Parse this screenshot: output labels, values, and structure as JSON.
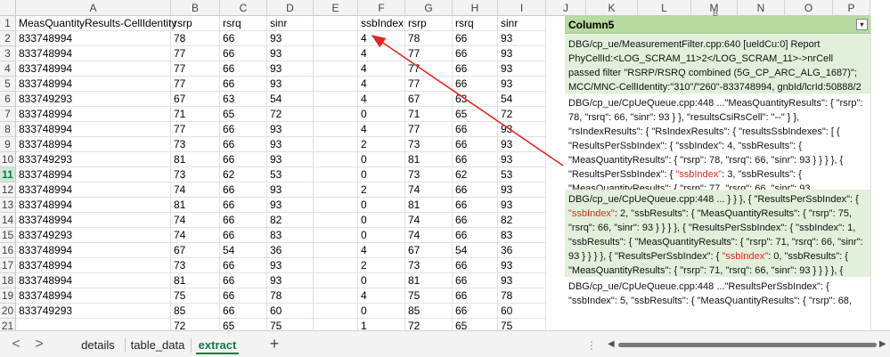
{
  "columns": [
    "A",
    "B",
    "C",
    "D",
    "E",
    "F",
    "G",
    "H",
    "I",
    "J",
    "K",
    "L",
    "M",
    "N",
    "O",
    "P"
  ],
  "column5_letter": "B",
  "rows": [
    {
      "num": "1",
      "cells": [
        "MeasQuantityResults-CellIdentity",
        "rsrp",
        "rsrq",
        "sinr",
        "",
        "ssbIndex",
        "rsrp",
        "rsrq",
        "sinr"
      ]
    },
    {
      "num": "2",
      "cells": [
        "833748994",
        "78",
        "66",
        "93",
        "",
        "4",
        "78",
        "66",
        "93"
      ]
    },
    {
      "num": "3",
      "cells": [
        "833748994",
        "77",
        "66",
        "93",
        "",
        "4",
        "77",
        "66",
        "93"
      ]
    },
    {
      "num": "4",
      "cells": [
        "833748994",
        "77",
        "66",
        "93",
        "",
        "4",
        "77",
        "66",
        "93"
      ]
    },
    {
      "num": "5",
      "cells": [
        "833748994",
        "77",
        "66",
        "93",
        "",
        "4",
        "77",
        "66",
        "93"
      ]
    },
    {
      "num": "6",
      "cells": [
        "833749293",
        "67",
        "63",
        "54",
        "",
        "4",
        "67",
        "63",
        "54"
      ]
    },
    {
      "num": "7",
      "cells": [
        "833748994",
        "71",
        "65",
        "72",
        "",
        "0",
        "71",
        "65",
        "72"
      ]
    },
    {
      "num": "8",
      "cells": [
        "833748994",
        "77",
        "66",
        "93",
        "",
        "4",
        "77",
        "66",
        "93"
      ]
    },
    {
      "num": "9",
      "cells": [
        "833748994",
        "73",
        "66",
        "93",
        "",
        "2",
        "73",
        "66",
        "93"
      ]
    },
    {
      "num": "10",
      "cells": [
        "833749293",
        "81",
        "66",
        "93",
        "",
        "0",
        "81",
        "66",
        "93"
      ]
    },
    {
      "num": "11",
      "cells": [
        "833748994",
        "73",
        "62",
        "53",
        "",
        "0",
        "73",
        "62",
        "53"
      ]
    },
    {
      "num": "12",
      "cells": [
        "833748994",
        "74",
        "66",
        "93",
        "",
        "2",
        "74",
        "66",
        "93"
      ]
    },
    {
      "num": "13",
      "cells": [
        "833748994",
        "81",
        "66",
        "93",
        "",
        "0",
        "81",
        "66",
        "93"
      ]
    },
    {
      "num": "14",
      "cells": [
        "833748994",
        "74",
        "66",
        "82",
        "",
        "0",
        "74",
        "66",
        "82"
      ]
    },
    {
      "num": "15",
      "cells": [
        "833749293",
        "74",
        "66",
        "83",
        "",
        "0",
        "74",
        "66",
        "83"
      ]
    },
    {
      "num": "16",
      "cells": [
        "833748994",
        "67",
        "54",
        "36",
        "",
        "4",
        "67",
        "54",
        "36"
      ]
    },
    {
      "num": "17",
      "cells": [
        "833748994",
        "73",
        "66",
        "93",
        "",
        "2",
        "73",
        "66",
        "93"
      ]
    },
    {
      "num": "18",
      "cells": [
        "833748994",
        "81",
        "66",
        "93",
        "",
        "0",
        "81",
        "66",
        "93"
      ]
    },
    {
      "num": "19",
      "cells": [
        "833748994",
        "75",
        "66",
        "78",
        "",
        "4",
        "75",
        "66",
        "78"
      ]
    },
    {
      "num": "20",
      "cells": [
        "833749293",
        "85",
        "66",
        "60",
        "",
        "0",
        "85",
        "66",
        "60"
      ]
    },
    {
      "num": "21",
      "cells": [
        "",
        "72",
        "65",
        "75",
        "",
        "1",
        "72",
        "65",
        "75"
      ]
    }
  ],
  "panel": {
    "header": "Column5",
    "blocks": [
      {
        "parts": [
          {
            "t": "DBG/cp_ue/MeasurementFilter.cpp:640 [ueldCu:0] Report PhyCellId:<LOG_SCRAM_11>2</LOG_SCRAM_11>->nrCell passed filter \"RSRP/RSRQ combined (5G_CP_ARC_ALG_1687)\"; MCC/MNC-CellIdentity:\"310\"/\"260\"-833748994, gnbId/lcrId:50888/2"
          }
        ]
      },
      {
        "parts": [
          {
            "t": "DBG/cp_ue/CpUeQueue.cpp:448 ...\"MeasQuantityResults\": { \"rsrp\": 78, \"rsrq\": 66, \"sinr\": 93 } }, \"resultsCsiRsCell\": \"--\" } }, \"rsIndexResults\": { \"RsIndexResults\": { \"resultsSsbIndexes\": [ { \"ResultsPerSsbIndex\": { \"ssbIndex\": 4, \"ssbResults\": { \"MeasQuantityResults\": { \"rsrp\": 78, \"rsrq\": 66, \"sinr\": 93 } } } }, { \"ResultsPerSsbIndex\": { "
          },
          {
            "t": "\"ssbIndex\"",
            "hl": true
          },
          {
            "t": ": 3, \"ssbResults\": { \"MeasQuantityResults\": { \"rsrp\": 77, \"rsrq\": 66, \"sinr\": 93"
          }
        ]
      },
      {
        "parts": [
          {
            "t": "DBG/cp_ue/CpUeQueue.cpp:448 ... } } }, { \"ResultsPerSsbIndex\": { "
          },
          {
            "t": "\"ssbIndex\"",
            "hl": true
          },
          {
            "t": ": 2, \"ssbResults\": { \"MeasQuantityResults\": { \"rsrp\": 75, \"rsrq\": 66, \"sinr\": 93 } } } }, { \"ResultsPerSsbIndex\": { \"ssbIndex\": 1, \"ssbResults\": { \"MeasQuantityResults\": { \"rsrp\": 71, \"rsrq\": 66, \"sinr\": 93 } } } }, { \"ResultsPerSsbIndex\": { "
          },
          {
            "t": "\"ssbIndex\"",
            "hl": true
          },
          {
            "t": ": 0, \"ssbResults\": { \"MeasQuantityResults\": { \"rsrp\": 71, \"rsrq\": 66, \"sinr\": 93 } } } }, {"
          }
        ]
      },
      {
        "parts": [
          {
            "t": "DBG/cp_ue/CpUeQueue.cpp:448 ...\"ResultsPerSsbIndex\": { \"ssbIndex\": 5, \"ssbResults\": { \"MeasQuantityResults\": { \"rsrp\": 68,"
          }
        ]
      }
    ]
  },
  "sheet_tabs": [
    {
      "label": "details",
      "active": false
    },
    {
      "label": "table_data",
      "active": false
    },
    {
      "label": "extract",
      "active": true
    }
  ],
  "add_sheet": "+",
  "nav_prev": "<",
  "nav_next": ">",
  "scroll_dots": "⋮",
  "colors": {
    "accent": "#107c41",
    "panel_header": "#b7dba0",
    "panel_band": "#e2efda",
    "highlight": "#e2271e",
    "arrow": "#e2271e"
  }
}
